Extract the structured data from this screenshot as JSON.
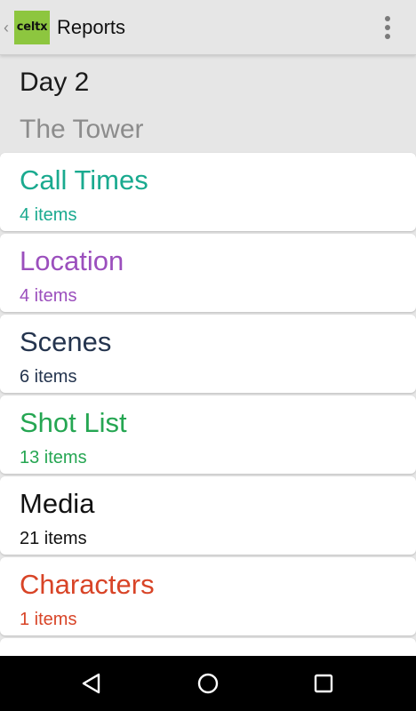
{
  "app_bar": {
    "back_glyph": "‹",
    "logo_text": "celtx",
    "title": "Reports",
    "menu_icon": "overflow-menu-icon"
  },
  "context": {
    "day": "Day 2",
    "location": "The Tower"
  },
  "reports": [
    {
      "title": "Call Times",
      "count": "4 items",
      "color": "#1aaa8f"
    },
    {
      "title": "Location",
      "count": "4 items",
      "color": "#9b4fbd"
    },
    {
      "title": "Scenes",
      "count": "6 items",
      "color": "#24344e"
    },
    {
      "title": "Shot List",
      "count": "13 items",
      "color": "#25a652"
    },
    {
      "title": "Media",
      "count": "21 items",
      "color": "#111111"
    },
    {
      "title": "Characters",
      "count": "1 items",
      "color": "#d84427"
    },
    {
      "title": "",
      "count": "",
      "color": "#24344e"
    }
  ],
  "nav": {
    "back_icon": "back-triangle-icon",
    "home_icon": "home-circle-icon",
    "recents_icon": "recents-square-icon"
  },
  "colors": {
    "app_bar_bg": "#e6e6e6",
    "logo_bg": "#8dc63f",
    "nav_bar_bg": "#000000"
  }
}
